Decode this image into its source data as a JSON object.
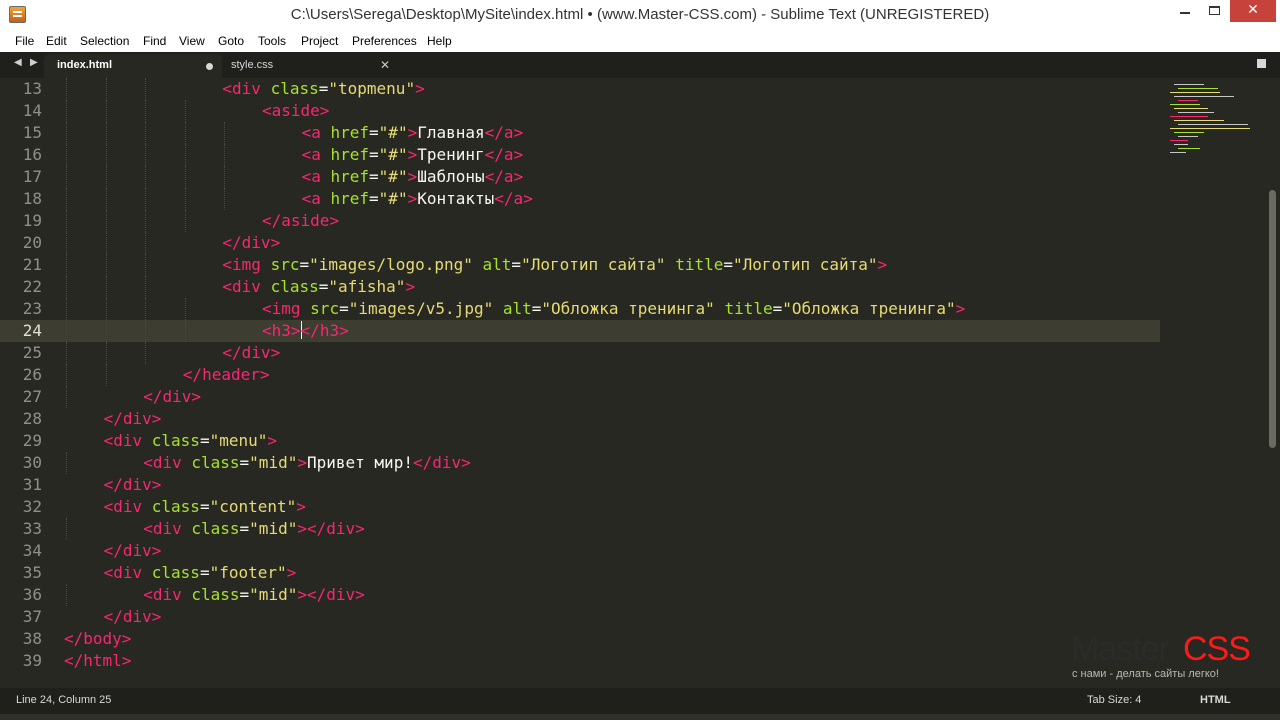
{
  "window": {
    "title": "C:\\Users\\Serega\\Desktop\\MySite\\index.html • (www.Master-CSS.com) - Sublime Text (UNREGISTERED)",
    "close_glyph": "✕",
    "minimize_icon": "minimize-icon",
    "maximize_icon": "maximize-icon"
  },
  "menu": [
    "File",
    "Edit",
    "Selection",
    "Find",
    "View",
    "Goto",
    "Tools",
    "Project",
    "Preferences",
    "Help"
  ],
  "tabs": {
    "prev_arrow": "◀",
    "next_arrow": "▶",
    "active": {
      "label": "index.html",
      "modified": true
    },
    "inactive": {
      "label": "style.css",
      "close_glyph": "✕"
    }
  },
  "editor": {
    "current_line": 24,
    "cursor_column": 25,
    "lines": [
      {
        "n": "13",
        "code": "<div class=\"topmenu\">"
      },
      {
        "n": "14",
        "code": "<aside>"
      },
      {
        "n": "15",
        "code": "<a href=\"#\">Главная</a>"
      },
      {
        "n": "16",
        "code": "<a href=\"#\">Тренинг</a>"
      },
      {
        "n": "17",
        "code": "<a href=\"#\">Шаблоны</a>"
      },
      {
        "n": "18",
        "code": "<a href=\"#\">Контакты</a>"
      },
      {
        "n": "19",
        "code": "</aside>"
      },
      {
        "n": "20",
        "code": "</div>"
      },
      {
        "n": "21",
        "code": "<img src=\"images/logo.png\" alt=\"Логотип сайта\" title=\"Логотип сайта\">"
      },
      {
        "n": "22",
        "code": "<div class=\"afisha\">"
      },
      {
        "n": "23",
        "code": "<img src=\"images/v5.jpg\" alt=\"Обложка тренинга\" title=\"Обложка тренинга\">"
      },
      {
        "n": "24",
        "code": "<h3></h3>"
      },
      {
        "n": "25",
        "code": "</div>"
      },
      {
        "n": "26",
        "code": "</header>"
      },
      {
        "n": "27",
        "code": "</div>"
      },
      {
        "n": "28",
        "code": "</div>"
      },
      {
        "n": "29",
        "code": "<div class=\"menu\">"
      },
      {
        "n": "30",
        "code": "<div class=\"mid\">Привет мир!</div>"
      },
      {
        "n": "31",
        "code": "</div>"
      },
      {
        "n": "32",
        "code": "<div class=\"content\">"
      },
      {
        "n": "33",
        "code": "<div class=\"mid\"></div>"
      },
      {
        "n": "34",
        "code": "</div>"
      },
      {
        "n": "35",
        "code": "<div class=\"footer\">"
      },
      {
        "n": "36",
        "code": "<div class=\"mid\"></div>"
      },
      {
        "n": "37",
        "code": "</div>"
      },
      {
        "n": "38",
        "code": "</body>"
      },
      {
        "n": "39",
        "code": "</html>"
      }
    ]
  },
  "watermark": {
    "brand_master": "Master",
    "brand_css": "CSS",
    "slogan": "с нами - делать сайты легко!"
  },
  "status": {
    "position": "Line 24, Column 25",
    "tab_size": "Tab Size: 4",
    "syntax": "HTML"
  },
  "colors": {
    "background": "#272822",
    "tag": "#f92672",
    "attribute": "#a6e22e",
    "string": "#e6db74",
    "text": "#f8f8f2",
    "line_number": "#8f908a",
    "brand_css": "#ff1a1a"
  }
}
